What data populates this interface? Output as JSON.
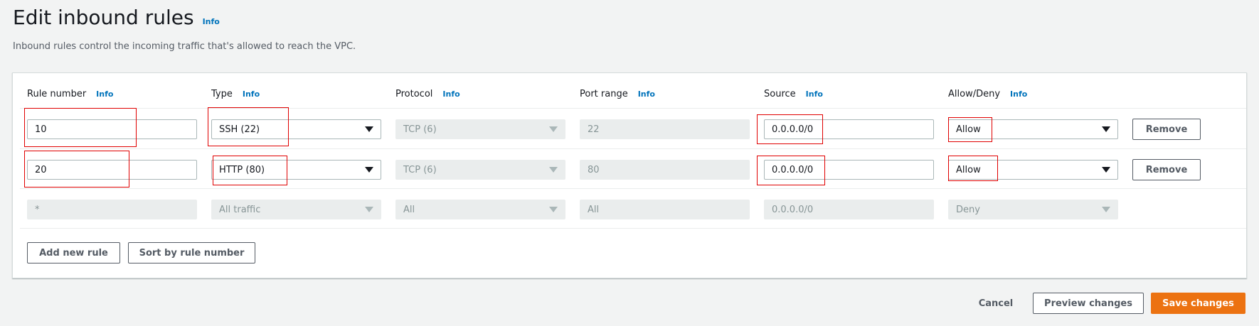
{
  "header": {
    "title": "Edit inbound rules",
    "info": "Info",
    "description": "Inbound rules control the incoming traffic that's allowed to reach the VPC."
  },
  "columns": [
    {
      "label": "Rule number",
      "info": "Info"
    },
    {
      "label": "Type",
      "info": "Info"
    },
    {
      "label": "Protocol",
      "info": "Info"
    },
    {
      "label": "Port range",
      "info": "Info"
    },
    {
      "label": "Source",
      "info": "Info"
    },
    {
      "label": "Allow/Deny",
      "info": "Info"
    }
  ],
  "rules": [
    {
      "rule_number": "10",
      "type": "SSH (22)",
      "protocol": "TCP (6)",
      "port_range": "22",
      "source": "0.0.0.0/0",
      "action": "Allow",
      "remove_label": "Remove"
    },
    {
      "rule_number": "20",
      "type": "HTTP (80)",
      "protocol": "TCP (6)",
      "port_range": "80",
      "source": "0.0.0.0/0",
      "action": "Allow",
      "remove_label": "Remove"
    },
    {
      "rule_number": "*",
      "type": "All traffic",
      "protocol": "All",
      "port_range": "All",
      "source": "0.0.0.0/0",
      "action": "Deny"
    }
  ],
  "actions": {
    "add_new_rule": "Add new rule",
    "sort_by_rule_number": "Sort by rule number"
  },
  "footer": {
    "cancel": "Cancel",
    "preview": "Preview changes",
    "save": "Save changes"
  },
  "colors": {
    "primary": "#ec7211",
    "link": "#0073bb",
    "highlight": "#e00000"
  }
}
